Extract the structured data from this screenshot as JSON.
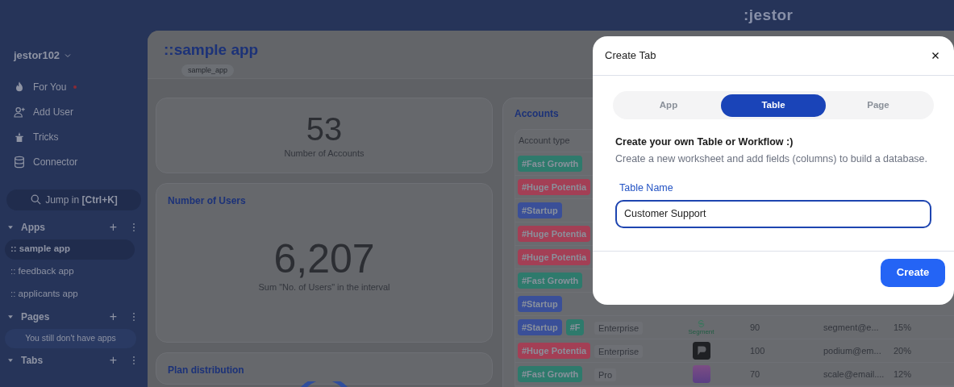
{
  "topbar": {
    "logo": ":jestor"
  },
  "sidebar": {
    "account": "jestor102",
    "nav": [
      {
        "kind": "flame",
        "label": "For You",
        "badge": true
      },
      {
        "kind": "user-plus",
        "label": "Add User",
        "badge": false
      },
      {
        "kind": "hat",
        "label": "Tricks",
        "badge": false
      },
      {
        "kind": "database",
        "label": "Connector",
        "badge": false
      }
    ],
    "jump": "Jump in **[Ctrl+K]**",
    "sections": [
      {
        "title": "Apps",
        "add": "+",
        "expanded": true,
        "items": [
          {
            "label": ":: sample app",
            "selected": true
          },
          {
            "label": ":: feedback app",
            "selected": false
          },
          {
            "label": ":: applicants app",
            "selected": false
          }
        ]
      },
      {
        "title": "Pages",
        "add": "+",
        "expanded": true,
        "empty": "You still don't have apps"
      },
      {
        "title": "Tabs",
        "add": "+",
        "expanded": true
      }
    ]
  },
  "page": {
    "title": "::sample app",
    "slug": "sample_app"
  },
  "cards": [
    {
      "kind": "number",
      "value": "53",
      "caption": "Number of Accounts"
    },
    {
      "kind": "number",
      "title": "Number of Users",
      "value": "6,207",
      "caption": "Sum \"No. of Users\" in the interval"
    },
    {
      "kind": "donut",
      "title": "Plan distribution"
    }
  ],
  "accounts": {
    "title": "Accounts",
    "columns": [
      "Account type"
    ],
    "rows": [
      {
        "tags": [
          {
            "label": "#Fast Growth",
            "color": "#2e7a6c"
          }
        ]
      },
      {
        "tags": [
          {
            "label": "#Huge Potentia",
            "color": "#a33f55"
          }
        ]
      },
      {
        "tags": [
          {
            "label": "#Startup",
            "color": "#3a4f98"
          }
        ]
      },
      {
        "tags": [
          {
            "label": "#Huge Potentia",
            "color": "#a33f55"
          }
        ]
      },
      {
        "tags": [
          {
            "label": "#Huge Potentia",
            "color": "#a33f55"
          }
        ]
      },
      {
        "tags": [
          {
            "label": "#Fast Growth",
            "color": "#2e7a6c"
          }
        ]
      },
      {
        "tags": [
          {
            "label": "#Startup",
            "color": "#3a4f98"
          }
        ]
      },
      {
        "tags": [
          {
            "label": "#Startup",
            "color": "#3a4f98"
          },
          {
            "label": "#F",
            "color": "#2e7a6c"
          }
        ],
        "plan": "Enterprise",
        "logo": {
          "kind": "segment",
          "label": "Segment"
        },
        "users": "90",
        "email": "segment@e...",
        "rate": "15%"
      },
      {
        "tags": [
          {
            "label": "#Huge Potentia",
            "color": "#a33f55"
          }
        ],
        "plan": "Enterprise",
        "logo": {
          "kind": "podium"
        },
        "users": "100",
        "email": "podium@em...",
        "rate": "20%"
      },
      {
        "tags": [
          {
            "label": "#Fast Growth",
            "color": "#2e7a6c"
          }
        ],
        "plan": "Pro",
        "logo": {
          "kind": "scale"
        },
        "users": "70",
        "email": "scale@email....",
        "rate": "12%"
      }
    ]
  },
  "dialog": {
    "title": "Create Tab",
    "tabs": [
      {
        "label": "App",
        "selected": false
      },
      {
        "label": "Table",
        "selected": true
      },
      {
        "label": "Page",
        "selected": false
      }
    ],
    "heading": "Create your own Table or Workflow :)",
    "description": "Create a new worksheet and add fields (columns) to build a database.",
    "field_label": "Table Name",
    "field_value": "Customer Support",
    "button": "Create"
  }
}
